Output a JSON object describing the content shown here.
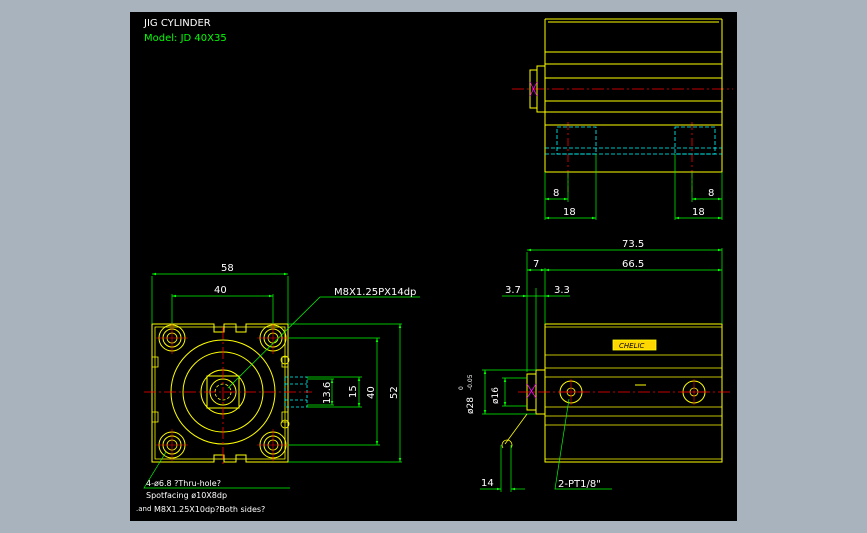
{
  "title": "JIG CYLINDER",
  "model": "Model: JD 40X35",
  "colors": {
    "background": "#a9b3be",
    "sheet": "#000000",
    "outline": "#ffff00",
    "dimension": "#00ff00",
    "text": "#ffffff",
    "centerline": "#ff0000",
    "hidden": "#00ffff",
    "highlight": "#ff00ff"
  },
  "top_view": {
    "dims": {
      "left_small": "8",
      "right_small": "8",
      "left_large": "18",
      "right_large": "18"
    }
  },
  "front_view": {
    "dims": {
      "width_outer": "58",
      "width_inner": "40",
      "height_outer": "52",
      "height_inner": "40",
      "port_15": "15",
      "port_13_6": "13.6"
    },
    "callout_thread": "M8X1.25PX14dp",
    "note_holes": "4-ø6.8 ?Thru-hole?",
    "note_spotfacing": "Spotfacing  ø10X8dp",
    "note_and": ".and",
    "note_tapped": "M8X1.25X10dp?Both sides?"
  },
  "side_view": {
    "dims": {
      "total": "73.5",
      "body": "66.5",
      "left_7": "7",
      "dim_3_7": "3.7",
      "dim_3_3": "3.3",
      "rod_dia": "ø16",
      "boss_dia": "ø28",
      "boss_tol_upper": "0",
      "boss_tol_lower": "-0.05",
      "bottom_14": "14"
    },
    "callout_port": "2-PT1/8\"",
    "label_plate": "CHELIC"
  }
}
